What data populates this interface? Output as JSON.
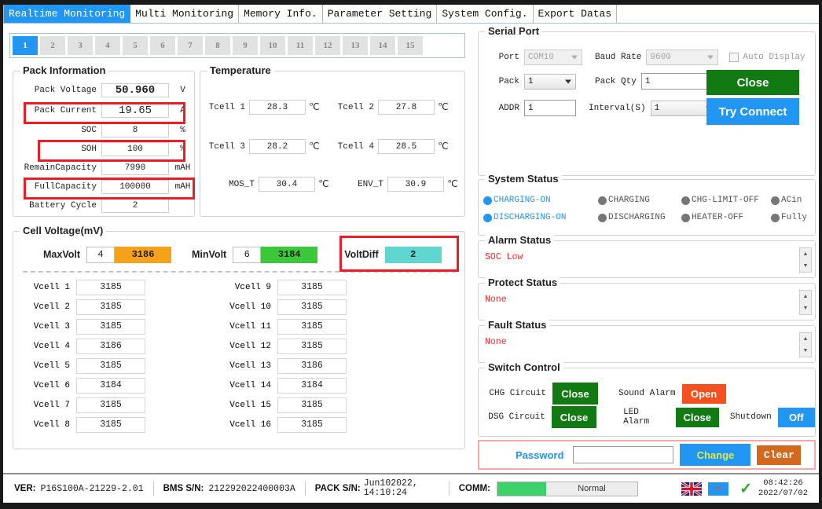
{
  "tabs": [
    {
      "label": "Realtime Monitoring",
      "active": true
    },
    {
      "label": "Multi Monitoring",
      "active": false
    },
    {
      "label": "Memory Info.",
      "active": false
    },
    {
      "label": "Parameter Setting",
      "active": false
    },
    {
      "label": "System Config.",
      "active": false
    },
    {
      "label": "Export Datas",
      "active": false
    }
  ],
  "pack_selector": {
    "items": [
      "1",
      "2",
      "3",
      "4",
      "5",
      "6",
      "7",
      "8",
      "9",
      "10",
      "11",
      "12",
      "13",
      "14",
      "15"
    ],
    "selected": "1"
  },
  "pack_information": {
    "title": "Pack Information",
    "rows": [
      {
        "label": "Pack Voltage",
        "value": "50.960",
        "unit": "V",
        "highlight": false,
        "bold": true
      },
      {
        "label": "Pack Current",
        "value": "19.65",
        "unit": "A",
        "highlight": true,
        "bold": true
      },
      {
        "label": "SOC",
        "value": "8",
        "unit": "%",
        "highlight": false,
        "bold": false
      },
      {
        "label": "SOH",
        "value": "100",
        "unit": "%",
        "highlight": true,
        "bold": false
      },
      {
        "label": "RemainCapacity",
        "value": "7990",
        "unit": "mAH",
        "highlight": false,
        "bold": false
      },
      {
        "label": "FullCapacity",
        "value": "100000",
        "unit": "mAH",
        "highlight": true,
        "bold": false
      },
      {
        "label": "Battery Cycle",
        "value": "2",
        "unit": "",
        "highlight": false,
        "bold": false
      }
    ]
  },
  "temperature": {
    "title": "Temperature",
    "unit": "℃",
    "sensors": [
      {
        "label": "Tcell 1",
        "value": "28.3"
      },
      {
        "label": "Tcell 2",
        "value": "27.8"
      },
      {
        "label": "Tcell 3",
        "value": "28.2"
      },
      {
        "label": "Tcell 4",
        "value": "28.5"
      },
      {
        "label": "MOS_T",
        "value": "30.4"
      },
      {
        "label": "ENV_T",
        "value": "30.9"
      }
    ]
  },
  "cell_voltage": {
    "title": "Cell Voltage(mV)",
    "max": {
      "label": "MaxVolt",
      "index": "4",
      "value": "3186",
      "color": "#f5a11a"
    },
    "min": {
      "label": "MinVolt",
      "index": "6",
      "value": "3184",
      "color": "#3bc93b"
    },
    "diff": {
      "label": "VoltDiff",
      "value": "2",
      "color": "#5fd6d0"
    },
    "cells": [
      {
        "label": "Vcell 1",
        "value": "3185"
      },
      {
        "label": "Vcell 2",
        "value": "3185"
      },
      {
        "label": "Vcell 3",
        "value": "3185"
      },
      {
        "label": "Vcell 4",
        "value": "3186"
      },
      {
        "label": "Vcell 5",
        "value": "3185"
      },
      {
        "label": "Vcell 6",
        "value": "3184"
      },
      {
        "label": "Vcell 7",
        "value": "3185"
      },
      {
        "label": "Vcell 8",
        "value": "3185"
      },
      {
        "label": "Vcell 9",
        "value": "3185"
      },
      {
        "label": "Vcell 10",
        "value": "3185"
      },
      {
        "label": "Vcell 11",
        "value": "3185"
      },
      {
        "label": "Vcell 12",
        "value": "3185"
      },
      {
        "label": "Vcell 13",
        "value": "3186"
      },
      {
        "label": "Vcell 14",
        "value": "3184"
      },
      {
        "label": "Vcell 15",
        "value": "3185"
      },
      {
        "label": "Vcell 16",
        "value": "3185"
      }
    ]
  },
  "serial_port": {
    "title": "Serial Port",
    "port_label": "Port",
    "port_value": "COM10",
    "baud_label": "Baud Rate",
    "baud_value": "9600",
    "auto_display_label": "Auto Display",
    "auto_display_checked": false,
    "pack_label": "Pack",
    "pack_value": "1",
    "pack_qty_label": "Pack Qty",
    "pack_qty_value": "1",
    "addr_label": "ADDR",
    "addr_value": "1",
    "interval_label": "Interval(S)",
    "interval_value": "1",
    "close_button": "Close",
    "try_connect_button": "Try Connect"
  },
  "system_status": {
    "title": "System Status",
    "indicators": [
      {
        "label": "CHARGING-ON",
        "on": true
      },
      {
        "label": "CHARGING",
        "on": false
      },
      {
        "label": "CHG-LIMIT-OFF",
        "on": false
      },
      {
        "label": "ACin",
        "on": false
      },
      {
        "label": "DISCHARGING-ON",
        "on": true
      },
      {
        "label": "DISCHARGING",
        "on": false
      },
      {
        "label": "HEATER-OFF",
        "on": false
      },
      {
        "label": "Fully",
        "on": false
      }
    ],
    "on_color": "#2196f3",
    "off_color": "#777777"
  },
  "alarm_status": {
    "title": "Alarm Status",
    "message": "SOC Low"
  },
  "protect_status": {
    "title": "Protect Status",
    "message": "None"
  },
  "fault_status": {
    "title": "Fault Status",
    "message": "None"
  },
  "switch_control": {
    "title": "Switch Control",
    "items": [
      {
        "label": "CHG Circuit",
        "state": "Close",
        "color": "#127a12"
      },
      {
        "label": "Sound Alarm",
        "state": "Open",
        "color": "#f4511e"
      },
      {
        "label": "DSG Circuit",
        "state": "Close",
        "color": "#127a12"
      },
      {
        "label": "LED Alarm",
        "state": "Close",
        "color": "#127a12"
      },
      {
        "label": "Shutdown",
        "state": "Off",
        "color": "#2196f3"
      }
    ]
  },
  "password_bar": {
    "label": "Password",
    "value": "",
    "change_button": "Change",
    "clear_button": "Clear",
    "change_color": "#2196f3",
    "clear_color": "#d2691e"
  },
  "status_bar": {
    "ver_label": "VER:",
    "ver_value": "P16S100A-21229-2.01",
    "bms_label": "BMS S/N:",
    "bms_value": "212292022400003A",
    "pack_label": "PACK S/N:",
    "pack_value": "Jun102022, 14:10:24",
    "comm_label": "COMM:",
    "comm_value": "Normal",
    "language_icon": "uk-flag-icon",
    "snip_icon": "scissors-icon",
    "ok_icon": "checkmark-icon",
    "time": "08:42:26",
    "date": "2022/07/02"
  }
}
